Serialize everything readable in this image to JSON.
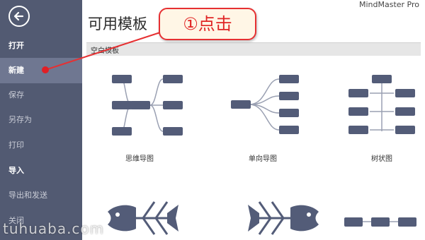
{
  "app": {
    "name": "MindMaster Pro"
  },
  "sidebar": {
    "items": [
      {
        "label": "打开"
      },
      {
        "label": "新建"
      },
      {
        "label": "保存"
      },
      {
        "label": "另存为"
      },
      {
        "label": "打印"
      },
      {
        "label": "导入"
      },
      {
        "label": "导出和发送"
      },
      {
        "label": "关闭"
      }
    ]
  },
  "main": {
    "title": "可用模板",
    "section": "空白模板",
    "templates": [
      {
        "label": "思维导图",
        "icon": "mind-map-icon"
      },
      {
        "label": "单向导图",
        "icon": "one-way-map-icon"
      },
      {
        "label": "树状图",
        "icon": "tree-diagram-icon"
      }
    ],
    "templates_row2": [
      {
        "icon": "fishbone-icon"
      },
      {
        "icon": "fishbone-reverse-icon"
      },
      {
        "icon": "timeline-icon"
      }
    ]
  },
  "callout": {
    "text": "①点击"
  },
  "watermark": "tuhuaba.com",
  "colors": {
    "sidebar": "#525a72",
    "sidebar_active": "#6f7791",
    "node": "#535c78",
    "callout_border": "#e63032",
    "callout_fill": "#fff6e6"
  }
}
